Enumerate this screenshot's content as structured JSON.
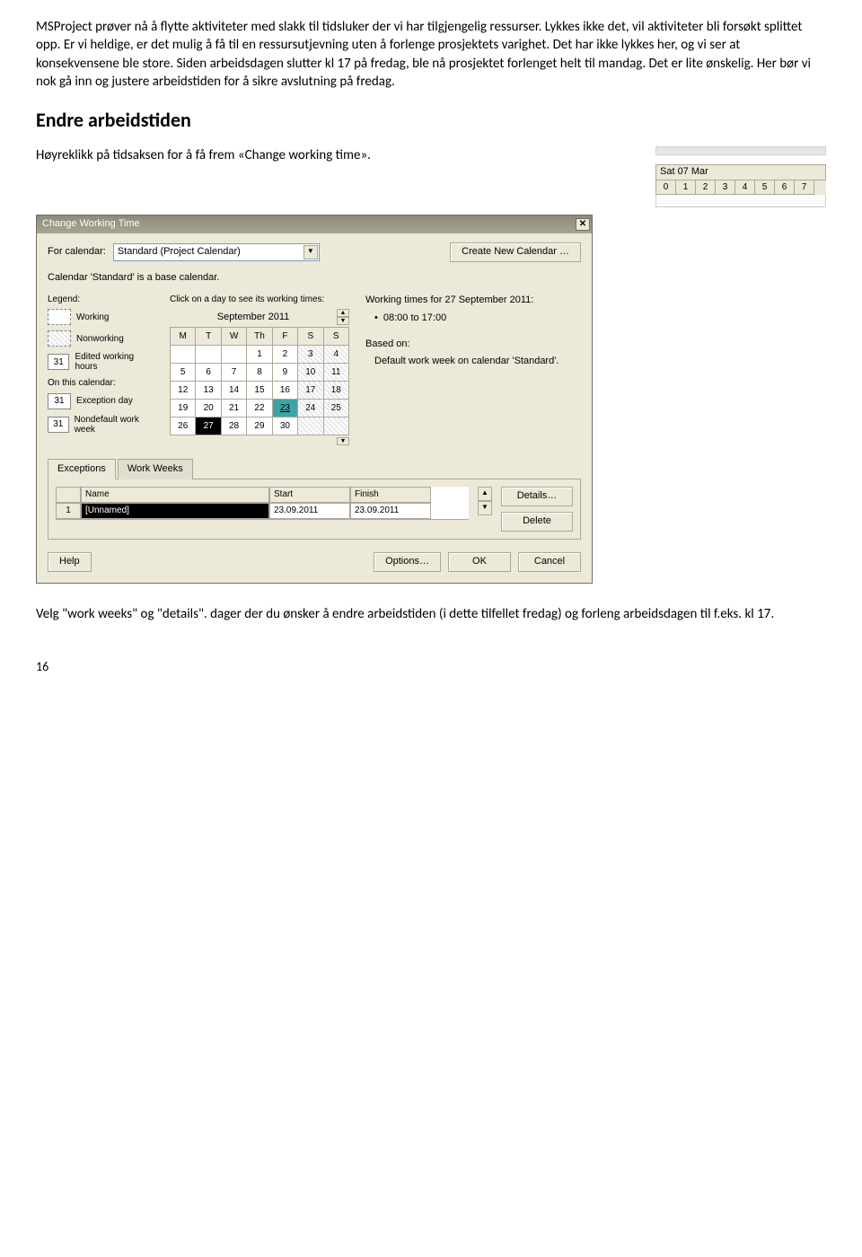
{
  "intro": {
    "p1": "MSProject prøver nå å flytte aktiviteter med slakk til tidsluker der vi har tilgjengelig ressurser. Lykkes ikke det, vil aktiviteter bli forsøkt splittet opp. Er vi heldige, er det mulig å få til en ressursutjevning uten å forlenge prosjektets varighet. Det har ikke lykkes her, og vi ser at konsekvensene ble store. Siden arbeidsdagen slutter kl 17 på fredag, ble nå prosjektet forlenget helt til mandag. Det er lite ønskelig. Her bør vi nok gå inn og justere arbeidstiden for å sikre avslutning på fredag."
  },
  "section_title": "Endre arbeidstiden",
  "instruction": "Høyreklikk på tidsaksen for å få frem «Change working time».",
  "timeline": {
    "day_label": "Sat 07 Mar",
    "hours": [
      "0",
      "1",
      "2",
      "3",
      "4",
      "5",
      "6",
      "7"
    ]
  },
  "dialog": {
    "title": "Change Working Time",
    "for_calendar_label": "For calendar:",
    "for_calendar_value": "Standard (Project Calendar)",
    "create_new_btn": "Create New Calendar …",
    "base_text": "Calendar 'Standard' is a base calendar.",
    "legend_title": "Legend:",
    "legend": {
      "working": "Working",
      "nonworking": "Nonworking",
      "edited": "Edited working hours",
      "on_this": "On this calendar:",
      "exception": "Exception day",
      "nondefault": "Nondefault work week",
      "box31": "31"
    },
    "click_hint": "Click on a day to see its working times:",
    "month": "September 2011",
    "dow": [
      "M",
      "T",
      "W",
      "Th",
      "F",
      "S",
      "S"
    ],
    "weeks": [
      [
        "",
        "",
        "",
        "1",
        "2",
        "3",
        "4"
      ],
      [
        "5",
        "6",
        "7",
        "8",
        "9",
        "10",
        "11"
      ],
      [
        "12",
        "13",
        "14",
        "15",
        "16",
        "17",
        "18"
      ],
      [
        "19",
        "20",
        "21",
        "22",
        "23",
        "24",
        "25"
      ],
      [
        "26",
        "27",
        "28",
        "29",
        "30",
        "",
        ""
      ]
    ],
    "wt_title": "Working times for 27 September 2011:",
    "wt_item": "08:00 to 17:00",
    "based_on_label": "Based on:",
    "based_on_value": "Default work week on calendar 'Standard'.",
    "tabs": {
      "exceptions": "Exceptions",
      "workweeks": "Work Weeks"
    },
    "grid": {
      "headers": {
        "name": "Name",
        "start": "Start",
        "finish": "Finish"
      },
      "rownum": "1",
      "row": {
        "name": "[Unnamed]",
        "start": "23.09.2011",
        "finish": "23.09.2011"
      }
    },
    "side_buttons": {
      "details": "Details…",
      "delete": "Delete"
    },
    "footer": {
      "help": "Help",
      "options": "Options…",
      "ok": "OK",
      "cancel": "Cancel"
    }
  },
  "closing": "Velg \"work weeks\" og \"details\". dager der du ønsker å endre arbeidstiden (i dette tilfellet fredag) og forleng arbeidsdagen til f.eks. kl 17.",
  "page_number": "16"
}
